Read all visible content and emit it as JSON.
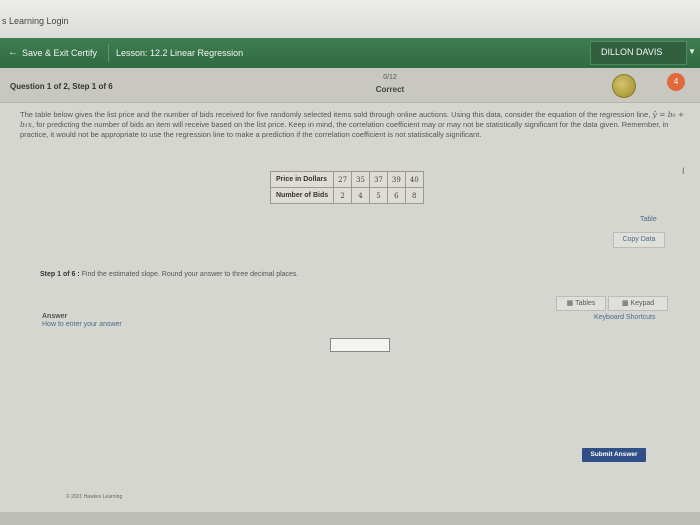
{
  "window": {
    "title": "s Learning Login"
  },
  "nav": {
    "save_exit": "Save & Exit Certify",
    "lesson": "Lesson: 12.2 Linear Regression",
    "user": "DILLON DAVIS"
  },
  "header": {
    "question": "Question 1 of 2, Step 1 of 6",
    "score": "0/12",
    "status": "Correct",
    "badge": "4"
  },
  "problem": {
    "text_1": "The table below gives the list price and the number of bids received for five randomly selected items sold through online auctions. Using this data, consider the equation of the regression line,",
    "formula": "ŷ = b₀ + b₁x",
    "text_2": ", for predicting the number of bids an item will receive based on the list price. Keep in mind, the correlation coefficient may or may not be statistically significant for the data given. Remember, in practice, it would not be appropriate to use the regression line to make a prediction if the correlation coefficient is not statistically significant."
  },
  "table": {
    "rows": [
      {
        "label": "Price in Dollars",
        "values": [
          "27",
          "35",
          "37",
          "39",
          "40"
        ]
      },
      {
        "label": "Number of Bids",
        "values": [
          "2",
          "4",
          "5",
          "6",
          "8"
        ]
      }
    ]
  },
  "links": {
    "table": "Table",
    "copy": "Copy Data"
  },
  "step": {
    "label": "Step 1 of 6 :",
    "text": "Find the estimated slope. Round your answer to three decimal places."
  },
  "tools": {
    "tables": "Tables",
    "keypad": "Keypad",
    "shortcuts": "Keyboard Shortcuts"
  },
  "answer": {
    "label": "Answer",
    "howto": "How to enter your answer",
    "value": ""
  },
  "submit": "Submit Answer",
  "footer": "© 2021 Hawkes Learning"
}
